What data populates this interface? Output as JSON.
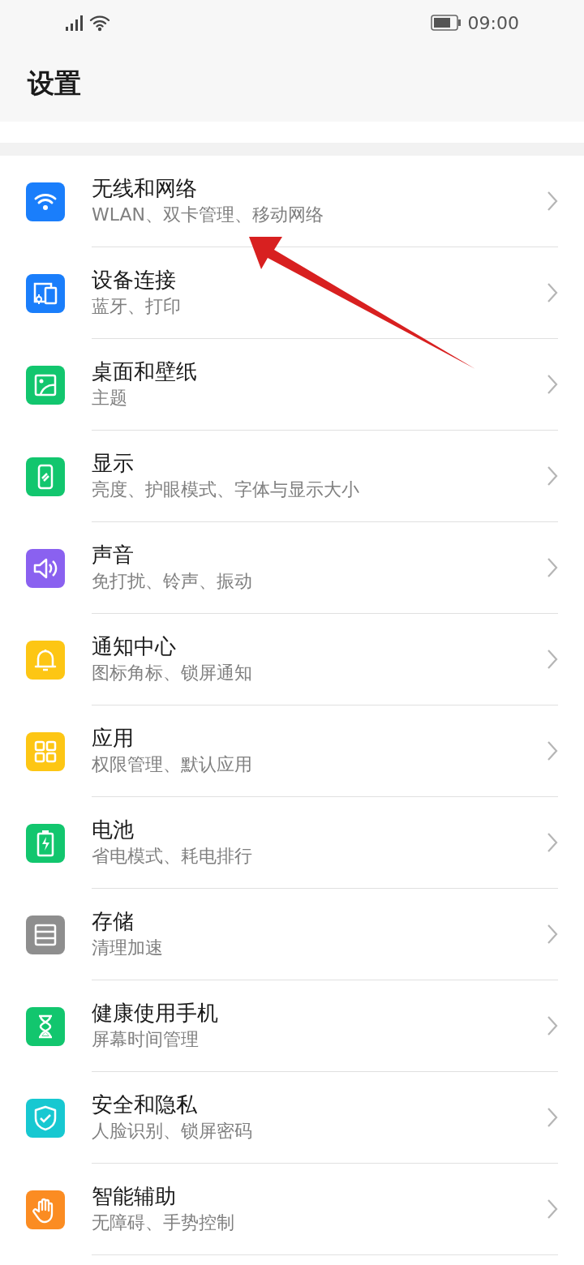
{
  "status_bar": {
    "time": "09:00"
  },
  "header": {
    "title": "设置"
  },
  "items": [
    {
      "title": "无线和网络",
      "subtitle": "WLAN、双卡管理、移动网络",
      "kind": "wifi",
      "color": "#1a7efb"
    },
    {
      "title": "设备连接",
      "subtitle": "蓝牙、打印",
      "kind": "devices",
      "color": "#1a7efb"
    },
    {
      "title": "桌面和壁纸",
      "subtitle": "主题",
      "kind": "wallpaper",
      "color": "#12c66e"
    },
    {
      "title": "显示",
      "subtitle": "亮度、护眼模式、字体与显示大小",
      "kind": "display",
      "color": "#12c66e"
    },
    {
      "title": "声音",
      "subtitle": "免打扰、铃声、振动",
      "kind": "sound",
      "color": "#8a61f0"
    },
    {
      "title": "通知中心",
      "subtitle": "图标角标、锁屏通知",
      "kind": "bell",
      "color": "#fdc614"
    },
    {
      "title": "应用",
      "subtitle": "权限管理、默认应用",
      "kind": "apps",
      "color": "#fdc614"
    },
    {
      "title": "电池",
      "subtitle": "省电模式、耗电排行",
      "kind": "battery",
      "color": "#12c66e"
    },
    {
      "title": "存储",
      "subtitle": "清理加速",
      "kind": "storage",
      "color": "#8e8e8e"
    },
    {
      "title": "健康使用手机",
      "subtitle": "屏幕时间管理",
      "kind": "hourglass",
      "color": "#12c66e"
    },
    {
      "title": "安全和隐私",
      "subtitle": "人脸识别、锁屏密码",
      "kind": "shield",
      "color": "#17c8d1"
    },
    {
      "title": "智能辅助",
      "subtitle": "无障碍、手势控制",
      "kind": "hand",
      "color": "#fb8c22"
    }
  ]
}
